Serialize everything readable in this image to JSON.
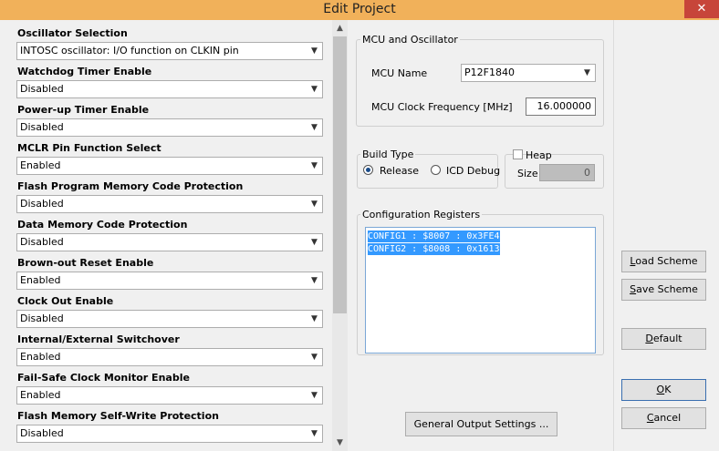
{
  "window": {
    "title": "Edit Project",
    "close_glyph": "✕"
  },
  "icons": {
    "dropdown": "chevron-down-icon",
    "scroll_up": "chevron-up-icon",
    "scroll_down": "chevron-down-icon"
  },
  "settings": [
    {
      "label": "Oscillator Selection",
      "value": "INTOSC oscillator: I/O function on CLKIN pin"
    },
    {
      "label": "Watchdog Timer Enable",
      "value": "Disabled"
    },
    {
      "label": "Power-up Timer Enable",
      "value": "Disabled"
    },
    {
      "label": "MCLR Pin Function Select",
      "value": "Enabled"
    },
    {
      "label": "Flash Program Memory Code Protection",
      "value": "Disabled"
    },
    {
      "label": "Data Memory Code Protection",
      "value": "Disabled"
    },
    {
      "label": "Brown-out Reset Enable",
      "value": "Enabled"
    },
    {
      "label": "Clock Out Enable",
      "value": "Disabled"
    },
    {
      "label": "Internal/External Switchover",
      "value": "Enabled"
    },
    {
      "label": "Fail-Safe Clock Monitor Enable",
      "value": "Enabled"
    },
    {
      "label": "Flash Memory Self-Write Protection",
      "value": "Disabled"
    }
  ],
  "mcu": {
    "group_title": "MCU and Oscillator",
    "name_label": "MCU Name",
    "name_value": "P12F1840",
    "freq_label": "MCU Clock Frequency [MHz]",
    "freq_value": "16.000000"
  },
  "build_type": {
    "group_title": "Build Type",
    "release_label": "Release",
    "icd_label": "ICD Debug",
    "selected": "Release"
  },
  "heap": {
    "label": "Heap",
    "size_label": "Size",
    "size_value": "0",
    "enabled": false
  },
  "config_registers": {
    "group_title": "Configuration Registers",
    "lines": [
      "CONFIG1 : $8007 : 0x3FE4",
      "CONFIG2 : $8008 : 0x1613"
    ]
  },
  "buttons": {
    "general_output": "General Output Settings ...",
    "load_scheme": {
      "first": "L",
      "rest": "oad Scheme"
    },
    "save_scheme": {
      "first": "S",
      "rest": "ave Scheme"
    },
    "default": {
      "first": "D",
      "rest": "efault"
    },
    "ok": {
      "first": "O",
      "rest": "K"
    },
    "cancel": {
      "first": "C",
      "rest": "ancel"
    }
  },
  "colors": {
    "titlebar": "#f1b15a",
    "close": "#c7453a",
    "selection": "#3399ff"
  }
}
